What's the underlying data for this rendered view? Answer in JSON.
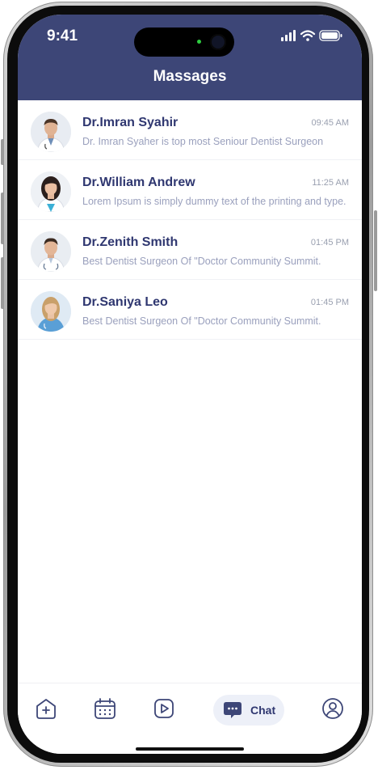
{
  "status_bar": {
    "time": "9:41"
  },
  "header": {
    "title": "Massages"
  },
  "conversations": [
    {
      "name": "Dr.Imran Syahir",
      "time": "09:45 AM",
      "message": "Dr. Imran Syaher is top most Seniour Dentist Surgeon",
      "avatar": "doctor-avatar-male"
    },
    {
      "name": "Dr.William Andrew",
      "time": "11:25 AM",
      "message": "Lorem Ipsum is simply dummy text of the printing and type.",
      "avatar": "doctor-avatar-female"
    },
    {
      "name": "Dr.Zenith Smith",
      "time": "01:45 PM",
      "message": "Best Dentist Surgeon Of \"Doctor Community Summit.",
      "avatar": "doctor-avatar-male"
    },
    {
      "name": "Dr.Saniya Leo",
      "time": "01:45 PM",
      "message": "Best Dentist Surgeon Of \"Doctor Community Summit.",
      "avatar": "doctor-avatar-female"
    }
  ],
  "bottom_nav": {
    "items": [
      "home-add-icon",
      "calendar-icon",
      "play-icon",
      "chat-icon",
      "profile-icon"
    ],
    "active_label": "Chat"
  },
  "colors": {
    "header_bg": "#3d4677",
    "name_text": "#2f3770",
    "message_text": "#9aa0bd",
    "nav_icon": "#3d4677",
    "active_pill": "#edf0f8"
  }
}
